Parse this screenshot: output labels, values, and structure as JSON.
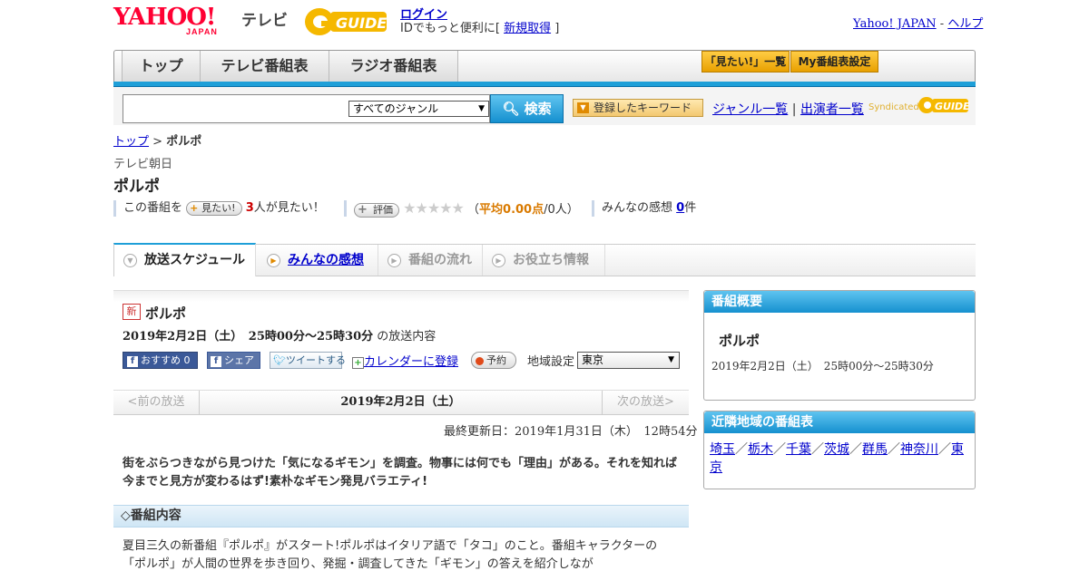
{
  "header": {
    "yahoo_logo": "YAHOO!",
    "yahoo_logo_sub": "JAPAN",
    "tv_label": "テレビ",
    "gguide_logo": "GUIDE",
    "login_link": "ログイン",
    "login_sub_prefix": "IDでもっと便利に[",
    "signup_link": "新規取得",
    "login_sub_suffix": "]",
    "yahoo_japan_link": "Yahoo! JAPAN",
    "separator": "-",
    "help_link": "ヘルプ"
  },
  "nav": {
    "tabs": [
      "トップ",
      "テレビ番組表",
      "ラジオ番組表"
    ],
    "mitai_list": "「見たい!」一覧",
    "my_bangumi": "My番組表設定"
  },
  "search": {
    "placeholder": "",
    "genre_selected": "すべてのジャンル",
    "button": "検索",
    "keyword_button": "登録したキーワード",
    "genre_list_link": "ジャンル一覧",
    "divider": "|",
    "performer_list_link": "出演者一覧",
    "syndicated": "Syndicated"
  },
  "breadcrumb": {
    "top": "トップ",
    "sep": ">",
    "current": "ポルポ"
  },
  "program": {
    "station": "テレビ朝日",
    "title": "ポルポ",
    "stats": {
      "this_program": "この番組を",
      "mitai_pill": "見たい!",
      "mitai_count": "3",
      "mitai_suffix": "人が見たい！",
      "rating_pill": "評価",
      "stars": "★★★★★",
      "avg_prefix": "（",
      "avg_label": "平均",
      "avg_value": "0.00点",
      "avg_people": "/0人）",
      "impressions_label": "みんなの感想",
      "impressions_count": "0",
      "impressions_suffix": "件"
    }
  },
  "tabs": [
    {
      "label": "放送スケジュール"
    },
    {
      "label": "みんなの感想"
    },
    {
      "label": "番組の流れ"
    },
    {
      "label": "お役立ち情報"
    }
  ],
  "broadcast": {
    "new_badge": "新",
    "title": "ポルポ",
    "datetime": "2019年2月2日（土）　25時00分～25時30分",
    "datetime_suffix": "の放送内容",
    "fb_recommend": "おすすめ 0",
    "fb_share": "シェア",
    "tweet": "ツイートする",
    "calendar": "カレンダーに登録",
    "reserve": "予約",
    "region_label": "地域設定",
    "region_selected": "東京"
  },
  "pager": {
    "prev": "<前の放送",
    "current": "2019年2月2日（土）",
    "next": "次の放送>"
  },
  "updated": "最終更新日：2019年1月31日（木）　12時54分",
  "description": "街をぶらつきながら見つけた「気になるギモン」を調査。物事には何でも「理由」がある。それを知れば今までと見方が変わるはず!素朴なギモン発見バラエティ!",
  "section_heading": "◇番組内容",
  "content_text": "夏目三久の新番組『ポルポ』がスタート!ポルポはイタリア語で「タコ」のこと。番組キャラクターの「ポルポ」が人間の世界を歩き回り、発掘・調査してきた「ギモン」の答えを紹介しなが",
  "sidebar": {
    "overview_heading": "番組概要",
    "overview_title": "ポルポ",
    "overview_datetime": "2019年2月2日（土）　25時00分～25時30分",
    "nearby_heading": "近隣地域の番組表",
    "nearby": [
      "埼玉",
      "栃木",
      "千葉",
      "茨城",
      "群馬",
      "神奈川",
      "東京"
    ],
    "nearby_sep": "／"
  },
  "colors": {
    "accent_blue": "#1e9fd8",
    "yahoo_red": "#ff0033",
    "link": "#0000cc",
    "gguide_yellow": "#f5b800",
    "mitai_count": "#cc0000",
    "avg_orange": "#d97a00"
  }
}
